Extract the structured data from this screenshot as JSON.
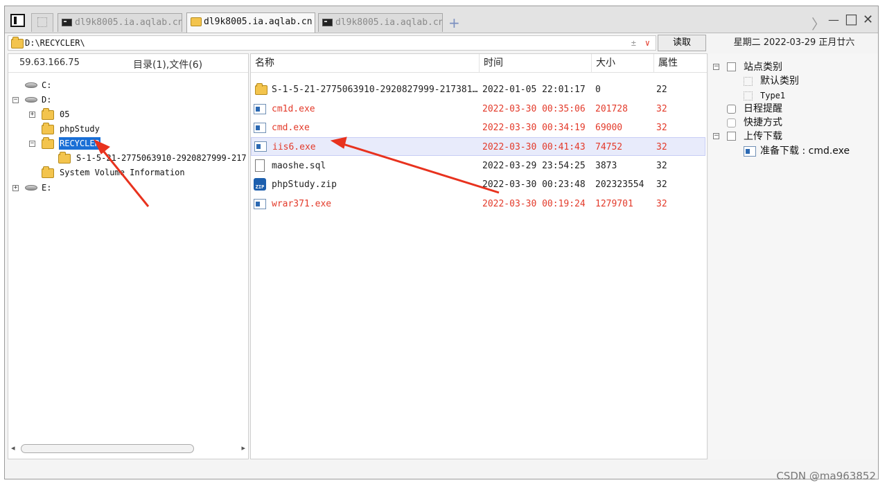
{
  "tabs": [
    {
      "label": "dl9k8005.ia.aqlab.cn",
      "active": false,
      "icon": "terminal-icon"
    },
    {
      "label": "dl9k8005.ia.aqlab.cn",
      "active": true,
      "icon": "folder-icon"
    },
    {
      "label": "dl9k8005.ia.aqlab.cn",
      "active": false,
      "icon": "terminal-icon"
    }
  ],
  "add_tab": "+",
  "window_buttons": {
    "nav": "〉",
    "minimize": "—",
    "maximize": "□",
    "close": "✕"
  },
  "address": {
    "path": "D:\\RECYCLER\\",
    "pin": "±",
    "dropdown": "∨",
    "read_button": "读取"
  },
  "date_bar": "星期二  2022-03-29  正月廿六",
  "left_panel": {
    "ip": "59.63.166.75",
    "summary": "目录(1),文件(6)",
    "tree": [
      {
        "label": "C:",
        "type": "drive"
      },
      {
        "label": "D:",
        "type": "drive",
        "expander": "−"
      },
      {
        "label": "05",
        "type": "folder",
        "expander": "+"
      },
      {
        "label": "phpStudy",
        "type": "folder"
      },
      {
        "label": "RECYCLER",
        "type": "folder",
        "expander": "−",
        "selected": true
      },
      {
        "label": "S-1-5-21-2775063910-2920827999-217",
        "type": "folder"
      },
      {
        "label": "System Volume Information",
        "type": "folder"
      },
      {
        "label": "E:",
        "type": "drive",
        "expander": "+"
      }
    ],
    "scroll_left": "◂",
    "scroll_right": "▸"
  },
  "file_list": {
    "columns": [
      "名称",
      "时间",
      "大小",
      "属性"
    ],
    "rows": [
      {
        "name": "S-1-5-21-2775063910-2920827999-217381...",
        "time": "2022-01-05 22:01:17",
        "size": "0",
        "attr": "22",
        "type": "folder",
        "red": false
      },
      {
        "name": "cm1d.exe",
        "time": "2022-03-30 00:35:06",
        "size": "201728",
        "attr": "32",
        "type": "exe",
        "red": true
      },
      {
        "name": "cmd.exe",
        "time": "2022-03-30 00:34:19",
        "size": "69000",
        "attr": "32",
        "type": "exe",
        "red": true
      },
      {
        "name": "iis6.exe",
        "time": "2022-03-30 00:41:43",
        "size": "74752",
        "attr": "32",
        "type": "exe",
        "red": true,
        "highlighted": true
      },
      {
        "name": "maoshe.sql",
        "time": "2022-03-29 23:54:25",
        "size": "3873",
        "attr": "32",
        "type": "file",
        "red": false
      },
      {
        "name": "phpStudy.zip",
        "time": "2022-03-30 00:23:48",
        "size": "202323554",
        "attr": "32",
        "type": "zip",
        "red": false
      },
      {
        "name": "wrar371.exe",
        "time": "2022-03-30 00:19:24",
        "size": "1279701",
        "attr": "32",
        "type": "exe",
        "red": true
      }
    ]
  },
  "right_panel": {
    "site_category": "站点类别",
    "default_category": "默认类别",
    "type1": "Type1",
    "schedule": "日程提醒",
    "shortcut": "快捷方式",
    "upload_download": "上传下载",
    "pending_download": "准备下载 : cmd.exe",
    "collapse": "−"
  },
  "watermark": "CSDN @ma963852",
  "colors": {
    "red_text": "#e33a2a",
    "selection": "#1a6fd6",
    "arrow": "#e8321e"
  }
}
